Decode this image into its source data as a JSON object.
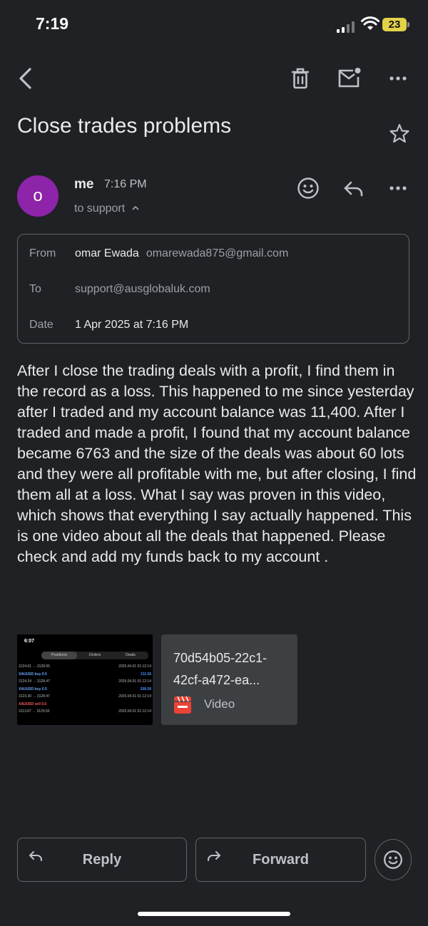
{
  "status_bar": {
    "time": "7:19",
    "battery": "23"
  },
  "email": {
    "subject": "Close trades problems",
    "sender_initial": "o",
    "sender_name": "me",
    "sent_time": "7:16 PM",
    "to_summary": "to support",
    "details": {
      "from_label": "From",
      "from_name": "omar Ewada",
      "from_email": "omarewada875@gmail.com",
      "to_label": "To",
      "to_value": "support@ausglobaluk.com",
      "date_label": "Date",
      "date_value": "1 Apr 2025 at 7:16 PM"
    },
    "body": "After I close the trading deals with a profit, I find them in the record as a loss. This happened to me since yesterday after I traded and my account balance was 11,400. After I traded and made a profit, I found that my account balance became 6763 and the size of the deals was about 60 lots and they were all profitable with me, but after closing, I find them all at a loss. What I say was proven in this video, which shows that everything I say actually happened. This is one video about all the deals that happened. Please check and add my funds back to my account .",
    "attachment": {
      "name": "70d54b05-22c1-42cf-a472-ea...",
      "type": "Video",
      "thumbnail": {
        "time": "6:07",
        "tabs": [
          "Positions",
          "Orders",
          "Deals"
        ],
        "rows": [
          {
            "left": "3124.61 → 3128.55",
            "right": "2025.04.01 01:12:14"
          },
          {
            "left": "XAUUSD buy 0.5",
            "right": "211.58"
          },
          {
            "left": "3124.24 → 3128.47",
            "right": "2025.04.01 01:12:14"
          },
          {
            "left": "XAUUSD buy 0.5",
            "right": "208.58"
          },
          {
            "left": "3123.30 → 3128.47",
            "right": "2025.04.01 01:12:14"
          },
          {
            "left": "XAUUSD sell 0.5",
            "right": ""
          },
          {
            "left": "3113.87 → 3129.50",
            "right": "2025.04.01 01:12:14"
          }
        ]
      }
    }
  },
  "actions": {
    "reply": "Reply",
    "forward": "Forward"
  },
  "colors": {
    "background": "#202124",
    "avatar": "#8e24aa",
    "battery": "#e3d14a",
    "video_icon": "#ea4335"
  },
  "icons": [
    "back-icon",
    "trash-icon",
    "mark-unread-icon",
    "more-icon",
    "star-icon",
    "emoji-icon",
    "reply-icon",
    "chevron-up-icon",
    "video-icon",
    "forward-icon"
  ]
}
